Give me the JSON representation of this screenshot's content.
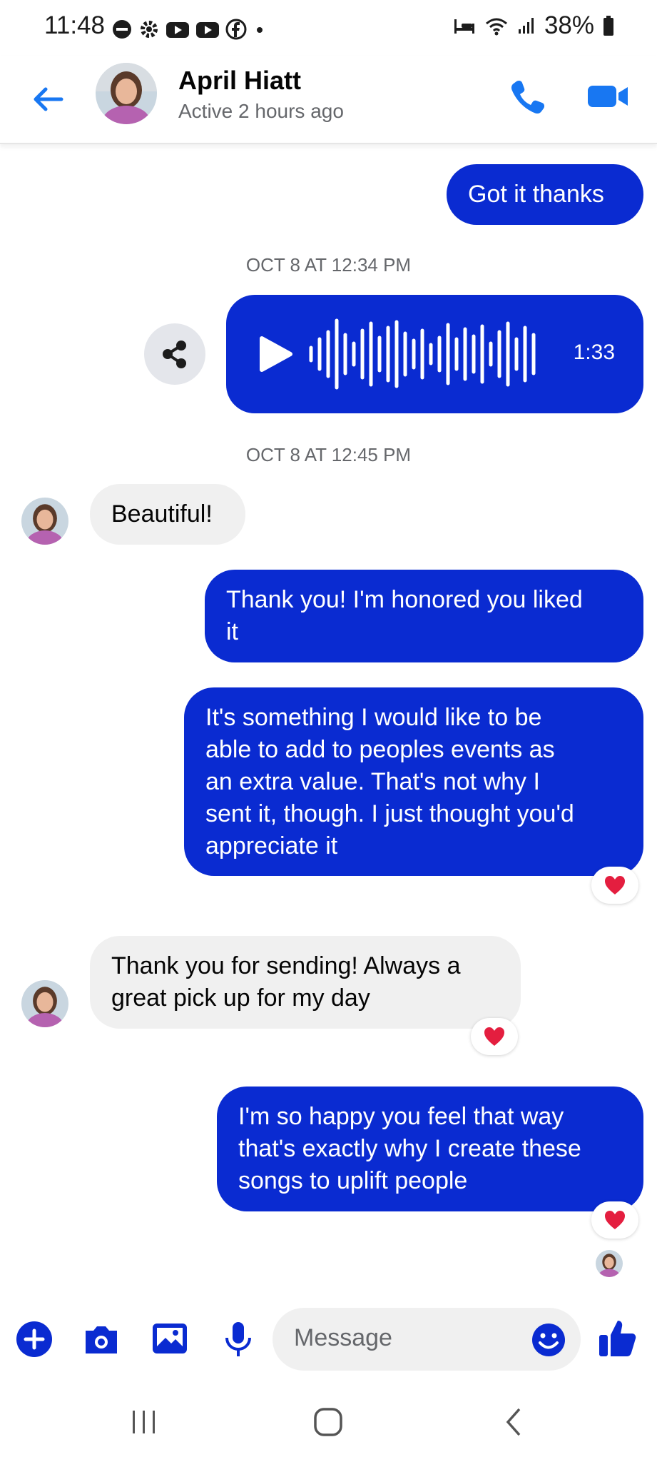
{
  "status_bar": {
    "time": "11:48",
    "battery": "38%",
    "notification_icons": [
      "do-not-disturb-icon",
      "settings-icon",
      "youtube-icon",
      "youtube-icon",
      "facebook-icon",
      "dot-icon"
    ]
  },
  "header": {
    "contact_name": "April Hiatt",
    "status": "Active 2 hours ago",
    "accent_color": "#1877f2"
  },
  "messages": {
    "m1": "Got it thanks",
    "ts1": "OCT 8 AT 12:34 PM",
    "voice_duration": "1:33",
    "ts2": "OCT 8 AT 12:45 PM",
    "m2": "Beautiful!",
    "m3_l1": "Thank you! I'm honored you liked",
    "m3_l2": "it",
    "m4_l1": "It's something I would like to be",
    "m4_l2": "able to add to peoples events as",
    "m4_l3": "an extra value. That's not why I",
    "m4_l4": "sent it, though. I just thought you'd",
    "m4_l5": "appreciate it",
    "m5_l1": "Thank you for sending! Always a",
    "m5_l2": "great pick up for my day",
    "m6_l1": "I'm so happy you feel that way",
    "m6_l2": "that's exactly why I create these",
    "m6_l3": "songs to uplift people",
    "outgoing_color": "#0a2bd1",
    "incoming_color": "#f0f0f0",
    "reaction": "heart-icon"
  },
  "composer": {
    "placeholder": "Message",
    "accent_color": "#0a2bd1"
  }
}
